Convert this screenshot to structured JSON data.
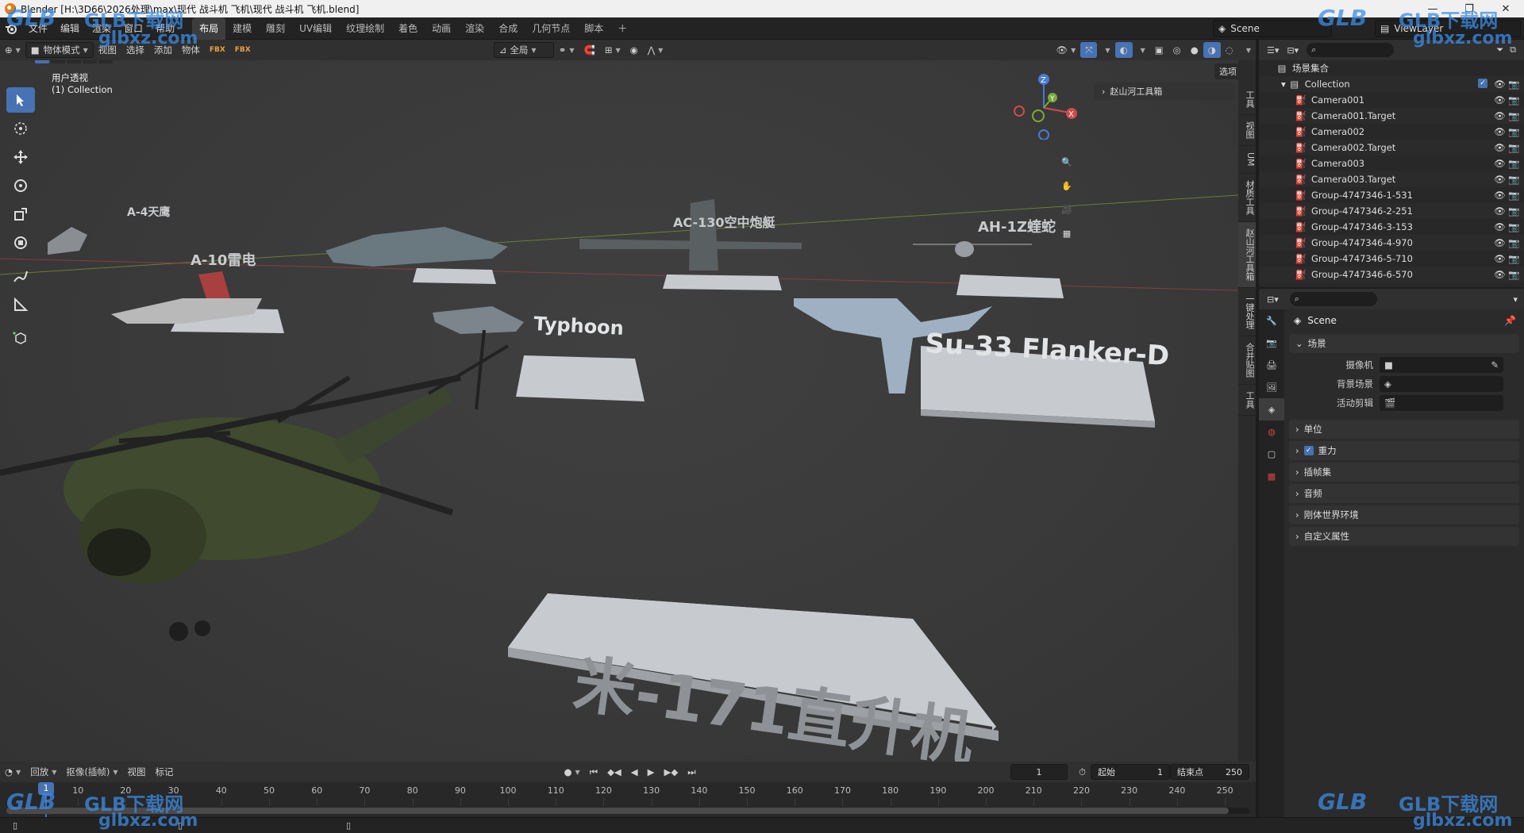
{
  "window": {
    "title": "Blender [H:\\3D66\\2026处理\\max\\现代 战斗机 飞机\\现代 战斗机 飞机.blend]"
  },
  "menus": [
    "文件",
    "编辑",
    "渲染",
    "窗口",
    "帮助"
  ],
  "workspaces": [
    "布局",
    "建模",
    "雕刻",
    "UV编辑",
    "纹理绘制",
    "着色",
    "动画",
    "渲染",
    "合成",
    "几何节点",
    "脚本"
  ],
  "active_workspace": "布局",
  "scene_name": "Scene",
  "view_layer": "ViewLayer",
  "viewport_header": {
    "mode": "物体模式",
    "menus": [
      "视图",
      "选择",
      "添加",
      "物体"
    ],
    "transform_orientation": "全局",
    "options_label": "选项"
  },
  "viewport": {
    "view_name": "用户透视",
    "collection_label": "(1) Collection",
    "sidebar_panel": "赵山河工具箱",
    "side_tabs": [
      "工具",
      "视图",
      "UM",
      "材质工具",
      "赵山河工具箱",
      "一键处理",
      "合并贴图",
      "工具"
    ],
    "active_side_tab": "赵山河工具箱",
    "scene_labels": [
      {
        "text": "米-171直升机"
      },
      {
        "text": "Su-33 Flanker-D"
      },
      {
        "text": "Typhoon"
      },
      {
        "text": "AH-1Z蝰蛇"
      },
      {
        "text": "AC-130空中炮艇"
      },
      {
        "text": "A-10雷电"
      },
      {
        "text": "A-4天鹰"
      }
    ]
  },
  "outliner": {
    "root": "场景集合",
    "collection": "Collection",
    "items": [
      "Camera001",
      "Camera001.Target",
      "Camera002",
      "Camera002.Target",
      "Camera003",
      "Camera003.Target",
      "Group-4747346-1-531",
      "Group-4747346-2-251",
      "Group-4747346-3-153",
      "Group-4747346-4-970",
      "Group-4747346-5-710",
      "Group-4747346-6-570"
    ]
  },
  "properties": {
    "title": "Scene",
    "scene_section": "场景",
    "fields": [
      {
        "label": "摄像机",
        "value": ""
      },
      {
        "label": "背景场景",
        "value": ""
      },
      {
        "label": "活动剪辑",
        "value": ""
      }
    ],
    "panels": [
      "单位",
      "重力",
      "插帧集",
      "音频",
      "刚体世界环境",
      "自定义属性"
    ]
  },
  "timeline": {
    "menus": [
      "回放",
      "抠像(插帧)",
      "视图",
      "标记"
    ],
    "current_frame": "1",
    "start_label": "起始",
    "start": "1",
    "end_label": "结束点",
    "end": "250",
    "ticks": [
      "10",
      "20",
      "30",
      "40",
      "50",
      "60",
      "70",
      "80",
      "90",
      "100",
      "110",
      "120",
      "130",
      "140",
      "150",
      "160",
      "170",
      "180",
      "190",
      "200",
      "210",
      "220",
      "230",
      "240",
      "250"
    ],
    "playhead_label": "1"
  },
  "watermark": {
    "brand": "GLB下载网",
    "url": "glbxz.com",
    "short": "GLB"
  }
}
